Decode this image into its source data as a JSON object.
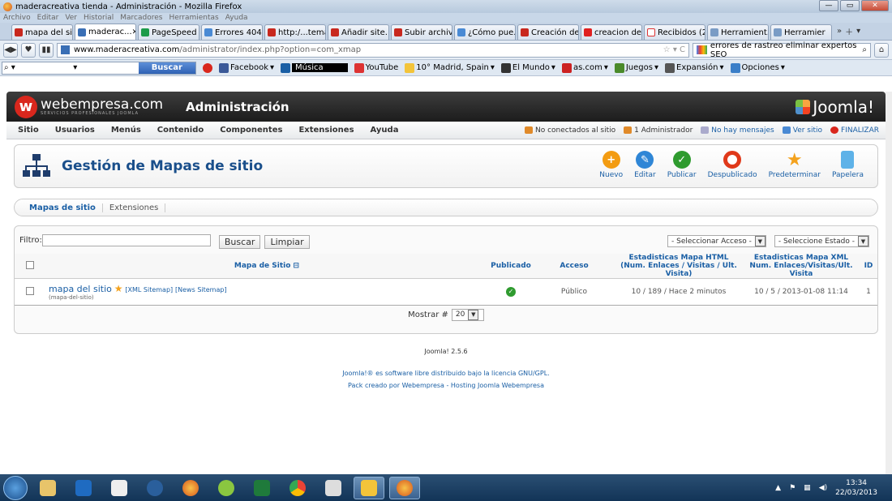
{
  "browser": {
    "window_title": "maderacreativa tienda - Administración - Mozilla Firefox",
    "menu": [
      "Archivo",
      "Editar",
      "Ver",
      "Historial",
      "Marcadores",
      "Herramientas",
      "Ayuda"
    ],
    "tabs": [
      "mapa del sit...",
      "maderac...",
      "PageSpeed I...",
      "Errores 404 I...",
      "http:/...temap",
      "Añadir site...",
      "Subir archiv...",
      "¿Cómo pue...",
      "Creación de...",
      "creacion de ...",
      "Recibidos (2...",
      "Herramient...",
      "Herramier"
    ],
    "url_domain": "www.maderacreativa.com",
    "url_path": "/administrator/index.php?option=com_xmap",
    "search_query": "errores de rastreo eliminar  expertos SEO",
    "toolbar": {
      "search_button": "Buscar",
      "facebook": "Facebook",
      "music": "Música",
      "youtube": "YouTube",
      "weather": "10° Madrid, Spain",
      "elmundo": "El Mundo",
      "ascom": "as.com",
      "juegos": "Juegos",
      "expansion": "Expansión",
      "opciones": "Opciones"
    }
  },
  "header": {
    "brand": "webempresa.com",
    "brand_sub": "SERVICIOS PROFESIONALES JOOMLA",
    "title": "Administración",
    "joomla": "Joomla!"
  },
  "menu": [
    "Sitio",
    "Usuarios",
    "Menús",
    "Contenido",
    "Componentes",
    "Extensiones",
    "Ayuda"
  ],
  "status": {
    "offline": "No conectados al sitio",
    "admins": "1 Administrador",
    "messages": "No hay mensajes",
    "view": "Ver sitio",
    "logout": "FINALIZAR"
  },
  "page_title": "Gestión de Mapas de sitio",
  "actions": [
    "Nuevo",
    "Editar",
    "Publicar",
    "Despublicado",
    "Predeterminar",
    "Papelera"
  ],
  "subtabs": [
    "Mapas de sitio",
    "Extensiones"
  ],
  "filter": {
    "label": "Filtro:",
    "search": "Buscar",
    "clear": "Limpiar",
    "access": "- Seleccionar Acceso -",
    "state": "- Seleccione Estado -"
  },
  "table": {
    "headers": {
      "name": "Mapa de Sitio",
      "published": "Publicado",
      "access": "Acceso",
      "html": "Estadisticas Mapa HTML",
      "html_sub": "(Num. Enlaces / Visitas / Ult. Visita)",
      "xml": "Estadisticas Mapa XML",
      "xml_sub": "Num. Enlaces/Visitas/Ult. Visita",
      "id": "ID"
    },
    "rows": [
      {
        "name": "mapa del sitio",
        "xml": "[XML Sitemap]",
        "news": "[News Sitemap]",
        "alias": "(mapa-del-sitio)",
        "access": "Público",
        "html_stats": "10 / 189 / Hace 2 minutos",
        "xml_stats": "10 / 5 / 2013-01-08 11:14",
        "id": "1"
      }
    ]
  },
  "pagination": {
    "label": "Mostrar #",
    "value": "20"
  },
  "footer": {
    "version": "Joomla! 2.5.6",
    "license": "Joomla!® es software libre distribuido bajo la licencia GNU/GPL.",
    "pack": "Pack creado por Webempresa - Hosting Joomla Webempresa"
  },
  "taskbar": {
    "time": "13:34",
    "date": "22/03/2013"
  }
}
